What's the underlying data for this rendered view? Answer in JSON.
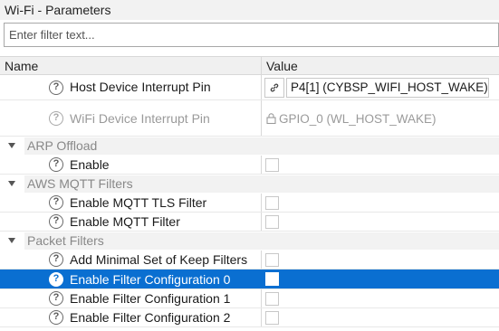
{
  "window": {
    "title": "Wi-Fi - Parameters"
  },
  "filter": {
    "placeholder": "Enter filter text..."
  },
  "columns": {
    "name": "Name",
    "value": "Value"
  },
  "rows": {
    "host_int": {
      "name": "Host Device Interrupt Pin",
      "value": "P4[1] (CYBSP_WIFI_HOST_WAKE)"
    },
    "wifi_int": {
      "name": "WiFi Device Interrupt Pin",
      "value": "GPIO_0 (WL_HOST_WAKE)"
    },
    "arp": {
      "label": "ARP Offload",
      "items": {
        "enable": {
          "name": "Enable",
          "checked": false
        }
      }
    },
    "aws": {
      "label": "AWS MQTT Filters",
      "items": {
        "tls": {
          "name": "Enable MQTT TLS Filter",
          "checked": false
        },
        "mqtt": {
          "name": "Enable MQTT Filter",
          "checked": false
        }
      }
    },
    "packet": {
      "label": "Packet Filters",
      "items": {
        "keep": {
          "name": "Add Minimal Set of Keep Filters",
          "checked": false
        },
        "cfg0": {
          "name": "Enable Filter Configuration 0",
          "checked": false,
          "selected": true
        },
        "cfg1": {
          "name": "Enable Filter Configuration 1",
          "checked": false
        },
        "cfg2": {
          "name": "Enable Filter Configuration 2",
          "checked": false
        }
      }
    }
  },
  "colors": {
    "selection": "#0a6fd1",
    "category_text": "#888888",
    "disabled_text": "#9a9a9a"
  }
}
